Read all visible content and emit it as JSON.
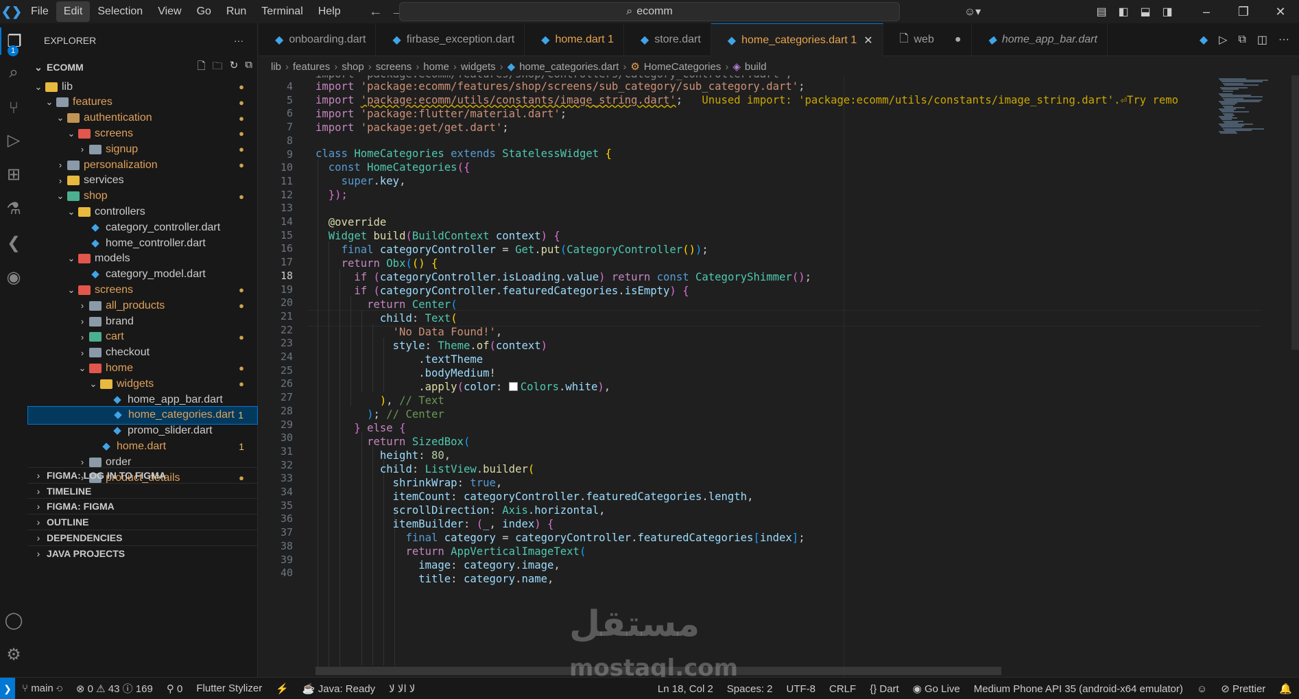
{
  "menu": [
    "File",
    "Edit",
    "Selection",
    "View",
    "Go",
    "Run",
    "Terminal",
    "Help"
  ],
  "search": {
    "text": "ecomm"
  },
  "activity": {
    "explorer_badge": "1"
  },
  "sidebar": {
    "title": "EXPLORER",
    "more": "···",
    "project": "ECOMM",
    "tree": [
      {
        "label": "lib",
        "mark": "●"
      },
      {
        "label": "features",
        "mark": "●"
      },
      {
        "label": "authentication",
        "mark": "●"
      },
      {
        "label": "screens",
        "mark": "●"
      },
      {
        "label": "signup",
        "mark": "●"
      },
      {
        "label": "personalization",
        "mark": "●"
      },
      {
        "label": "services",
        "mark": ""
      },
      {
        "label": "shop",
        "mark": "●"
      },
      {
        "label": "controllers",
        "mark": ""
      },
      {
        "label": "category_controller.dart",
        "mark": ""
      },
      {
        "label": "home_controller.dart",
        "mark": ""
      },
      {
        "label": "models",
        "mark": ""
      },
      {
        "label": "category_model.dart",
        "mark": ""
      },
      {
        "label": "screens",
        "mark": "●"
      },
      {
        "label": "all_products",
        "mark": "●"
      },
      {
        "label": "brand",
        "mark": ""
      },
      {
        "label": "cart",
        "mark": "●"
      },
      {
        "label": "checkout",
        "mark": ""
      },
      {
        "label": "home",
        "mark": "●"
      },
      {
        "label": "widgets",
        "mark": "●"
      },
      {
        "label": "home_app_bar.dart",
        "mark": ""
      },
      {
        "label": "home_categories.dart",
        "mark": "1"
      },
      {
        "label": "promo_slider.dart",
        "mark": ""
      },
      {
        "label": "home.dart",
        "mark": "1"
      },
      {
        "label": "order",
        "mark": ""
      },
      {
        "label": "product_details",
        "mark": "●"
      }
    ],
    "panels": [
      "FIGMA: LOG IN TO FIGMA",
      "TIMELINE",
      "FIGMA: FIGMA",
      "OUTLINE",
      "DEPENDENCIES",
      "JAVA PROJECTS"
    ]
  },
  "tabs": [
    {
      "label": "onboarding.dart",
      "extra": ""
    },
    {
      "label": "firbase_exception.dart",
      "extra": ""
    },
    {
      "label": "home.dart",
      "extra": "1"
    },
    {
      "label": "store.dart",
      "extra": ""
    },
    {
      "label": "home_categories.dart",
      "extra": "1"
    },
    {
      "label": "web",
      "extra": ""
    },
    {
      "label": "home_app_bar.dart",
      "extra": ""
    }
  ],
  "breadcrumb": [
    "lib",
    "features",
    "shop",
    "screens",
    "home",
    "widgets",
    "home_categories.dart",
    "HomeCategories",
    "build"
  ],
  "editor": {
    "line_numbers": [
      "4",
      "5",
      "6",
      "7",
      "8",
      "9",
      "10",
      "11",
      "12",
      "13",
      "14",
      "15",
      "16",
      "17",
      "18",
      "19",
      "20",
      "21",
      "22",
      "23",
      "24",
      "25",
      "26",
      "27",
      "28",
      "29",
      "30",
      "31",
      "32",
      "33",
      "34",
      "35",
      "36",
      "37",
      "38",
      "39",
      "40"
    ],
    "current_line": "18",
    "warning": "Unused import: 'package:ecomm/utils/constants/image_string.dart'.⏎Try remo",
    "top_partial": "import 'package:ecomm/features/shop/controllers/category_controller.dart';"
  },
  "watermark": {
    "arabic": "مستقل",
    "latin": "mostaql.com"
  },
  "statusbar": {
    "branch": "main",
    "problems": "0",
    "warnings": "43",
    "info": "169",
    "ports": "0",
    "stylizer": "Flutter Stylizer",
    "java": "Java: Ready",
    "arabic": "لا الا لا",
    "position": "Ln 18, Col 2",
    "spaces": "Spaces: 2",
    "encoding": "UTF-8",
    "eol": "CRLF",
    "lang": "Dart",
    "golive": "Go Live",
    "device": "Medium Phone API 35 (android-x64 emulator)",
    "prettier": "Prettier"
  }
}
